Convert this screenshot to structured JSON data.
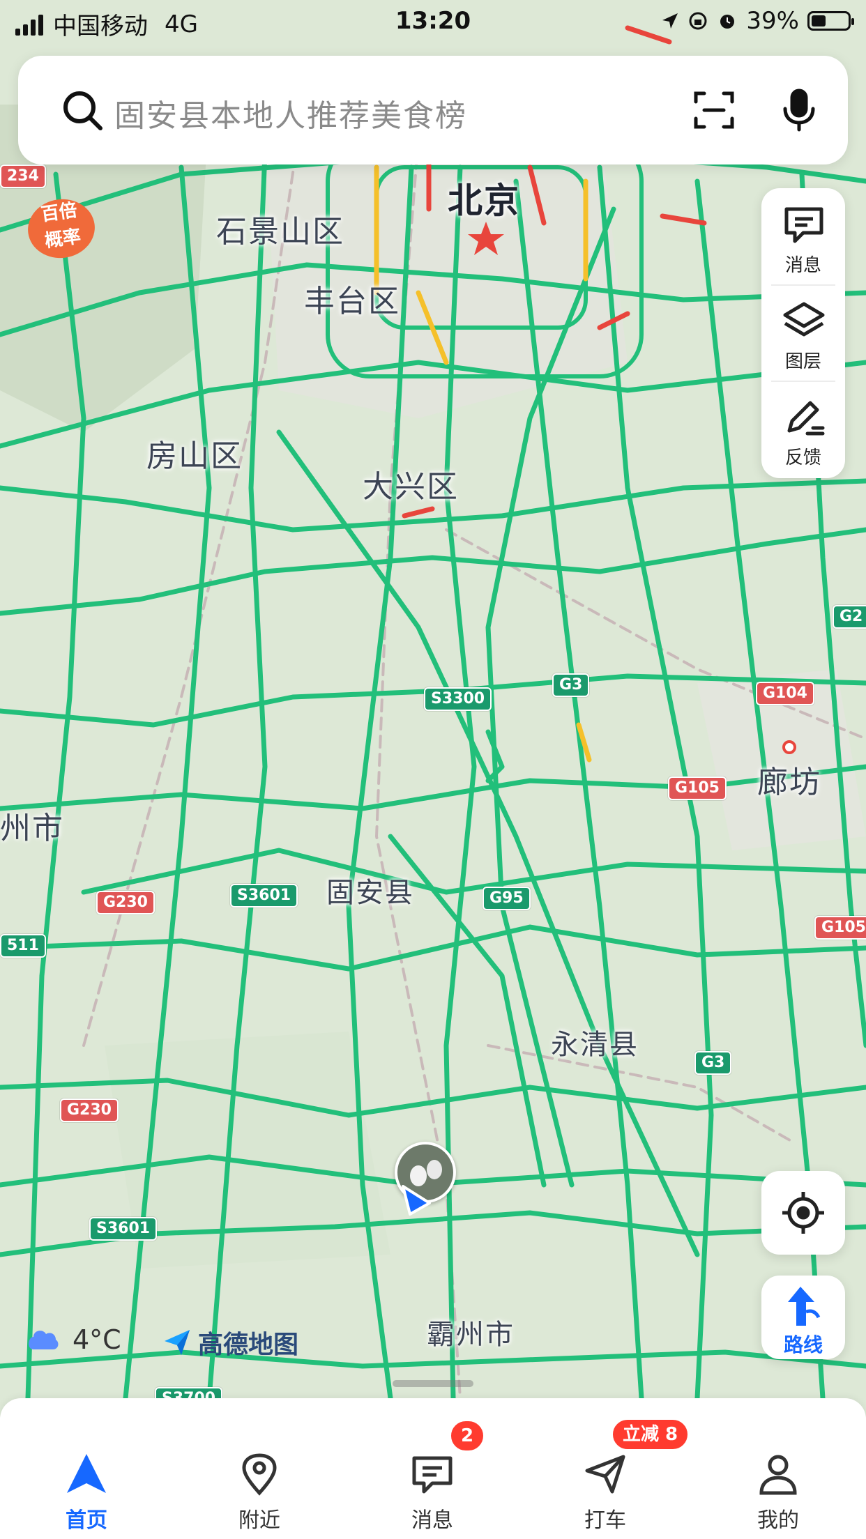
{
  "status_bar": {
    "carrier": "中国移动",
    "network": "4G",
    "time": "13:20",
    "battery": "39%",
    "battery_level": 0.39
  },
  "search": {
    "placeholder": "固安县本地人推荐美食榜",
    "icons": [
      "search-icon",
      "scan-icon",
      "microphone-icon"
    ]
  },
  "map_tools": {
    "items": [
      {
        "label": "消息",
        "icon": "message-icon"
      },
      {
        "label": "图层",
        "icon": "layers-icon"
      },
      {
        "label": "反馈",
        "icon": "feedback-pencil-icon"
      }
    ],
    "locate_icon": "locate-target-icon",
    "route_label": "路线"
  },
  "promo": {
    "label_line1": "百倍",
    "label_line2": "概率"
  },
  "map": {
    "places": [
      {
        "name": "北京",
        "major": true
      },
      {
        "name": "石景山区"
      },
      {
        "name": "丰台区"
      },
      {
        "name": "房山区"
      },
      {
        "name": "大兴区"
      },
      {
        "name": "廊坊"
      },
      {
        "name": "州市"
      },
      {
        "name": "固安县"
      },
      {
        "name": "永清县"
      },
      {
        "name": "霸州市"
      }
    ],
    "road_shields": [
      {
        "name": "234",
        "color": "red"
      },
      {
        "name": "S3300",
        "color": "green"
      },
      {
        "name": "G3",
        "color": "green"
      },
      {
        "name": "G104",
        "color": "red"
      },
      {
        "name": "G105",
        "color": "red"
      },
      {
        "name": "G230",
        "color": "red"
      },
      {
        "name": "S3601",
        "color": "green"
      },
      {
        "name": "G95",
        "color": "green"
      },
      {
        "name": "G105",
        "color": "red"
      },
      {
        "name": "511",
        "color": "green"
      },
      {
        "name": "G3",
        "color": "green"
      },
      {
        "name": "G230",
        "color": "red"
      },
      {
        "name": "S3601",
        "color": "green"
      },
      {
        "name": "S3700",
        "color": "green"
      },
      {
        "name": "G2",
        "color": "green"
      }
    ],
    "colors": {
      "road": "#1fbe78",
      "congested": "#e8453c",
      "slow": "#f5c02a",
      "land": "#dfe8d8"
    }
  },
  "weather": {
    "icon": "cloud-icon",
    "temperature": "4°C"
  },
  "brand": {
    "icon": "amap-logo-icon",
    "name": "高德地图"
  },
  "tab_bar": {
    "tabs": [
      {
        "label": "首页",
        "icon": "navigation-arrow-icon",
        "active": true
      },
      {
        "label": "附近",
        "icon": "location-pin-icon"
      },
      {
        "label": "消息",
        "icon": "message-icon",
        "badge": "2"
      },
      {
        "label": "打车",
        "icon": "taxi-send-icon",
        "badge": "立减 8"
      },
      {
        "label": "我的",
        "icon": "profile-icon"
      }
    ]
  }
}
